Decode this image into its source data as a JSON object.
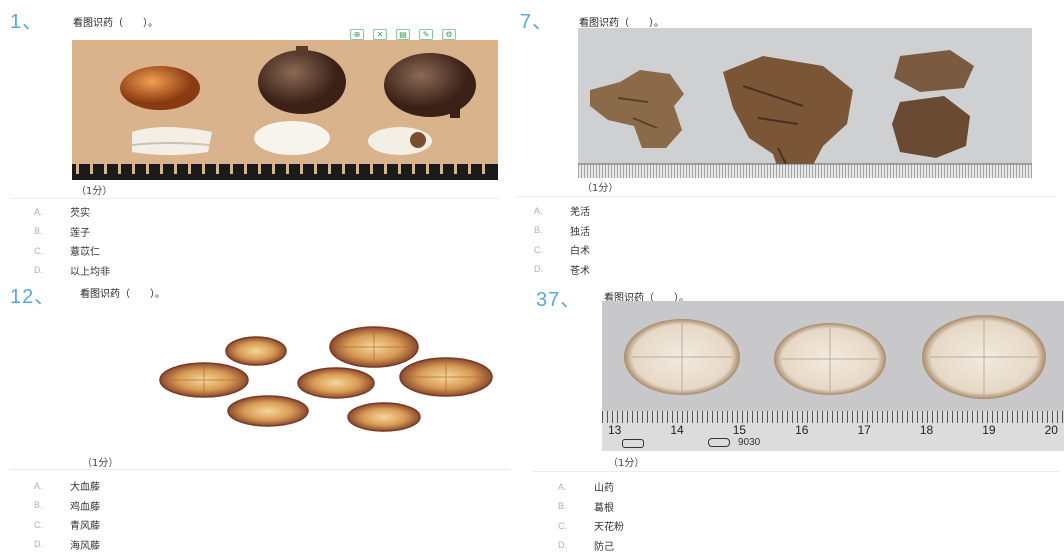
{
  "questions": [
    {
      "number": "1、",
      "title": "看图识药（　　）。",
      "score": "（1分）",
      "toolbar": [
        "zoom-icon",
        "fullscreen-icon",
        "save-icon",
        "edit-icon",
        "settings-icon"
      ],
      "options": [
        {
          "key": "A.",
          "text": "芡实"
        },
        {
          "key": "B.",
          "text": "莲子"
        },
        {
          "key": "C.",
          "text": "薏苡仁"
        },
        {
          "key": "D.",
          "text": "以上均非"
        }
      ]
    },
    {
      "number": "7、",
      "title": "看图识药（　　）。",
      "score": "（1分）",
      "options": [
        {
          "key": "A.",
          "text": "羌活"
        },
        {
          "key": "B.",
          "text": "独活"
        },
        {
          "key": "C.",
          "text": "白术"
        },
        {
          "key": "D.",
          "text": "苍术"
        }
      ]
    },
    {
      "number": "12、",
      "title": "看图识药（　　）。",
      "score": "（1分）",
      "options": [
        {
          "key": "A.",
          "text": "大血藤"
        },
        {
          "key": "B.",
          "text": "鸡血藤"
        },
        {
          "key": "C.",
          "text": "青风藤"
        },
        {
          "key": "D.",
          "text": "海风藤"
        }
      ]
    },
    {
      "number": "37、",
      "title": "看图识药（　　）。",
      "score": "（1分）",
      "ruler_numbers": [
        "13",
        "14",
        "15",
        "16",
        "17",
        "18",
        "19",
        "20"
      ],
      "ruler_code": "9030",
      "options": [
        {
          "key": "A.",
          "text": "山药"
        },
        {
          "key": "B.",
          "text": "葛根"
        },
        {
          "key": "C.",
          "text": "天花粉"
        },
        {
          "key": "D.",
          "text": "防己"
        }
      ]
    }
  ],
  "colors": {
    "number": "#5aa9d6",
    "option_key": "#b0b0b0",
    "tool": "#3f9a52"
  }
}
